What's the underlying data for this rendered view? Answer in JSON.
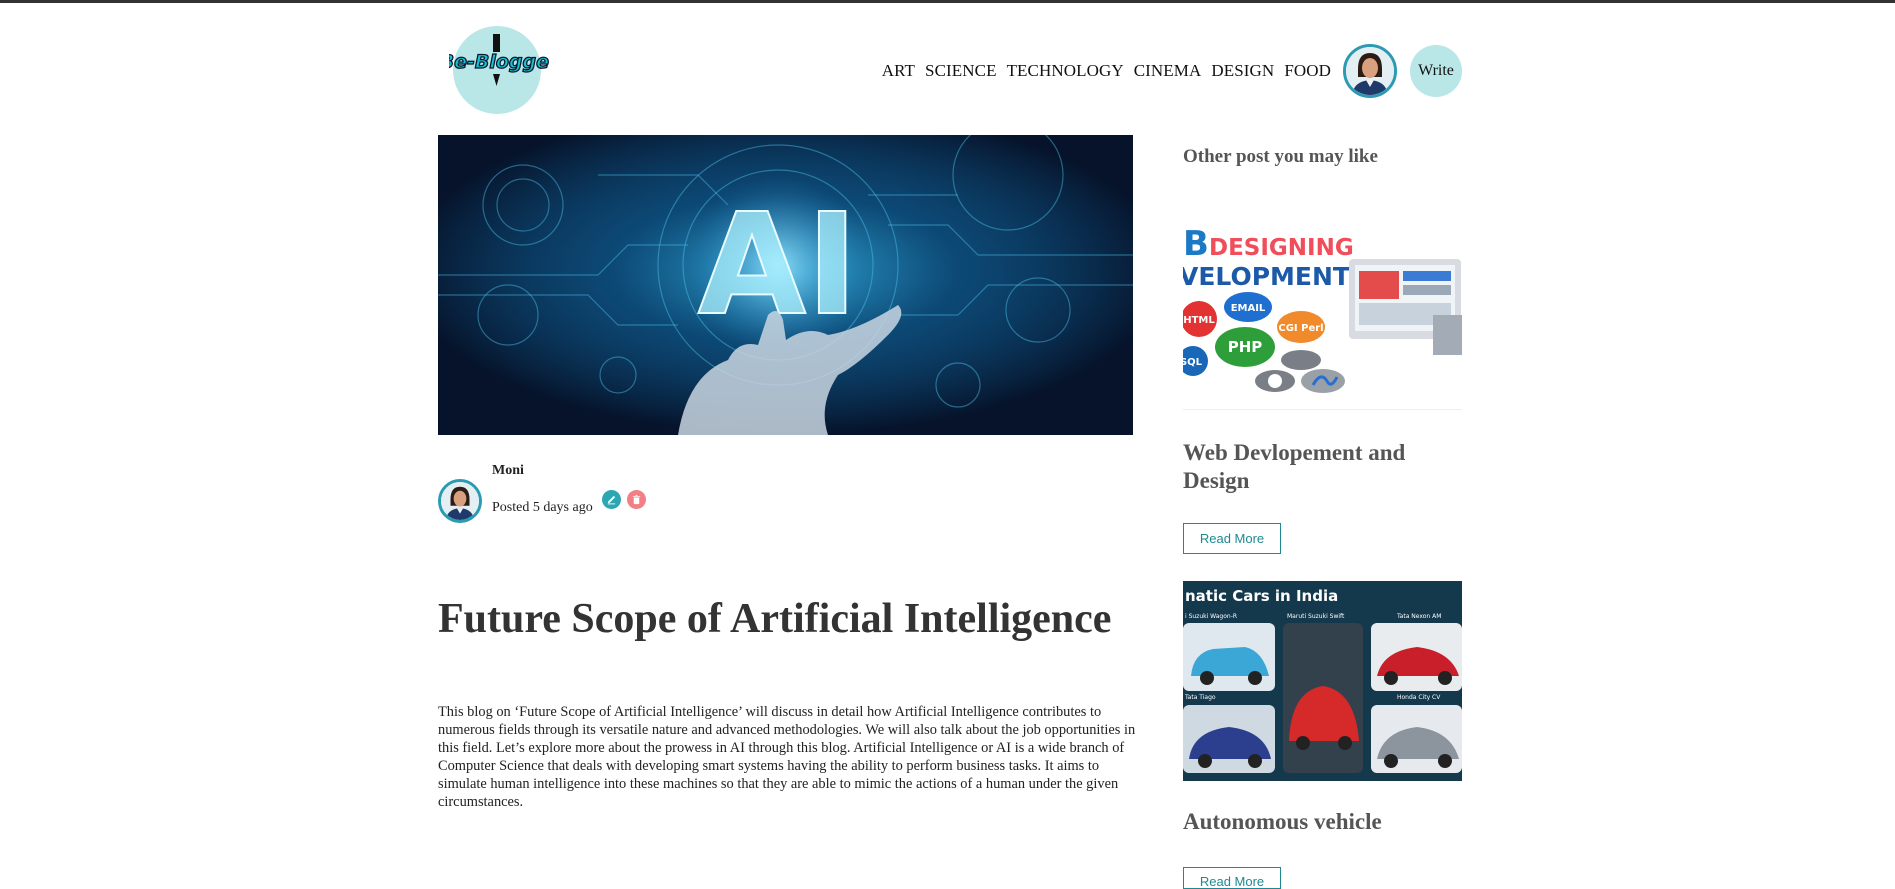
{
  "brand": {
    "logo_text": "Be-Blogger"
  },
  "nav": {
    "links": [
      "ART",
      "SCIENCE",
      "TECHNOLOGY",
      "CINEMA",
      "DESIGN",
      "FOOD"
    ],
    "write_label": "Write"
  },
  "post": {
    "hero_text": "AI",
    "author_name": "Moni",
    "posted": "Posted 5 days ago",
    "title": "Future Scope of Artificial Intelligence",
    "body": "This blog on ‘Future Scope of Artificial Intelligence’ will discuss in detail how Artificial Intelligence contributes to numerous fields through its versatile nature and advanced methodologies. We will also talk about the job opportunities in this field. Let’s explore more about the prowess in AI through this blog. Artificial Intelligence or AI is a wide branch of Computer Science that deals with developing smart systems having the ability to perform business tasks. It aims to simulate human intelligence into these machines so that they are able to mimic the actions of a human under the given circumstances."
  },
  "sidebar": {
    "heading": "Other post you may like",
    "posts": [
      {
        "title": "Web Devlopement and Design",
        "read_more": "Read More",
        "image_text": {
          "line1a": "B",
          "line1b": "DESIGNING",
          "line2": "VELOPMENT",
          "badges": [
            "HTML",
            "EMAIL",
            "PHP",
            "CGI Perl",
            "SQL"
          ]
        }
      },
      {
        "title": "Autonomous vehicle",
        "read_more": "Read More",
        "image_text": {
          "header": "natic Cars in India",
          "cars": [
            "i Suzuki Wagon-R",
            "Maruti Suzuki Swift",
            "Tata Nexon AM",
            "Tata Tiago",
            "",
            "Honda City CV"
          ]
        }
      }
    ]
  },
  "colors": {
    "accent": "#2a9bb3",
    "logo_bg": "#b9e6e6",
    "read_more": "#1c8a92",
    "delete": "#f27f85"
  }
}
